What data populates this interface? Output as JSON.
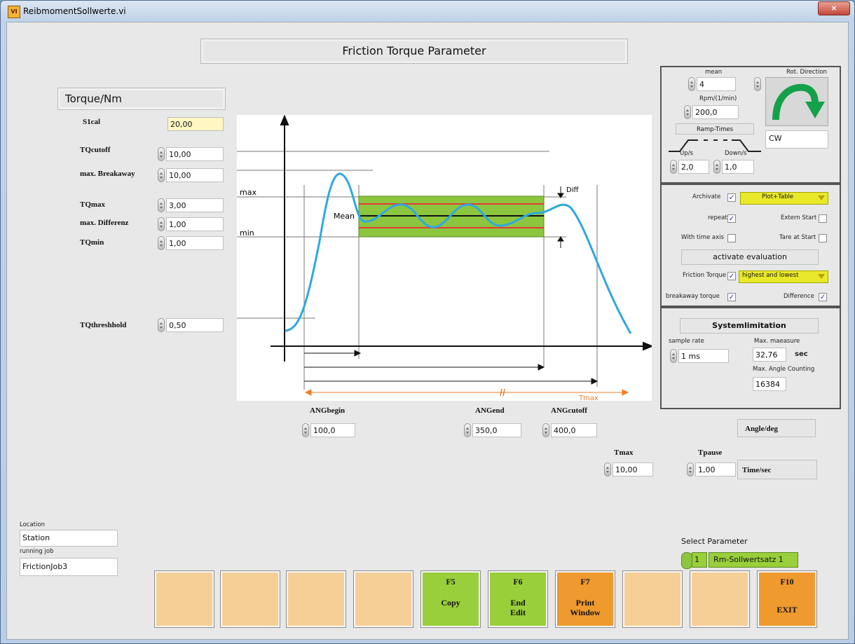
{
  "window": {
    "title": "ReibmomentSollwerte.vi",
    "app_icon": "labview-vi-icon",
    "close_glyph": "×"
  },
  "panel_title": "Friction Torque Parameter",
  "torque": {
    "heading": "Torque/Nm",
    "s1cal": {
      "label": "S1cal",
      "value": "20,00"
    },
    "tqcutoff": {
      "label": "TQcutoff",
      "value": "10,00"
    },
    "max_breakaway": {
      "label": "max. Breakaway",
      "value": "10,00"
    },
    "tqmax": {
      "label": "TQmax",
      "value": "3,00"
    },
    "max_differenz": {
      "label": "max. Differenz",
      "value": "1,00"
    },
    "tqmin": {
      "label": "TQmin",
      "value": "1,00"
    },
    "tqthreshhold": {
      "label": "TQthreshhold",
      "value": "0,50"
    }
  },
  "diagram": {
    "max": "max",
    "mean": "Mean",
    "min": "min",
    "diff": "Diff",
    "tmax": "Tmax",
    "colors": {
      "band": "#8cc63f",
      "red": "#e53935",
      "curve": "#2fa8e0",
      "arrow": "#f07d2a"
    }
  },
  "angles": {
    "angbegin": {
      "label": "ANGbegin",
      "value": "100,0"
    },
    "angend": {
      "label": "ANGend",
      "value": "350,0"
    },
    "angcutoff": {
      "label": "ANGcutoff",
      "value": "400,0"
    },
    "unit": "Angle/deg"
  },
  "times": {
    "tmax": {
      "label": "Tmax",
      "value": "10,00"
    },
    "tpause": {
      "label": "Tpause",
      "value": "1,00"
    },
    "unit": "Time/sec"
  },
  "drive": {
    "mean_label": "mean",
    "mean_value": "4",
    "rpm_label": "Rpm/(1/min)",
    "rpm_value": "200,0",
    "ramp_label": "Ramp-Times",
    "up_label": "Up/s",
    "up_value": "2,0",
    "down_label": "Down/s",
    "down_value": "1,0",
    "rot_label": "Rot. Direction",
    "rot_value": "CW"
  },
  "options": {
    "archivate": "Archivate",
    "archivate_mode": "Plot+Table",
    "repeat": "repeat",
    "extern_start": "Extern Start",
    "time_axis": "With time axis",
    "tare": "Tare at Start",
    "activate_eval": "activate evaluation",
    "friction_torque": "Friction Torque",
    "friction_mode": "highest and lowest",
    "breakaway": "breakaway torque",
    "difference": "Difference",
    "check": "✓"
  },
  "system": {
    "title": "Systemlimitation",
    "sample_rate_label": "sample rate",
    "sample_rate_value": "1 ms",
    "max_measure_label": "Max. maeasure",
    "max_measure_value": "32,76",
    "sec": "sec",
    "max_angle_label": "Max. Angle Counting",
    "max_angle_value": "16384"
  },
  "location": {
    "label": "Location",
    "value": "Station",
    "job_label": "running job",
    "job_value": "FrictionJob3"
  },
  "select_parameter": {
    "label": "Select Parameter",
    "index": "1",
    "name": "Rm-Sollwertsatz 1"
  },
  "fkeys": [
    {
      "key": "",
      "text": ""
    },
    {
      "key": "",
      "text": ""
    },
    {
      "key": "",
      "text": ""
    },
    {
      "key": "",
      "text": ""
    },
    {
      "key": "F5",
      "text": "Copy"
    },
    {
      "key": "F6",
      "text": "End\nEdit"
    },
    {
      "key": "F7",
      "text": "Print\nWindow"
    },
    {
      "key": "",
      "text": ""
    },
    {
      "key": "",
      "text": ""
    },
    {
      "key": "F10",
      "text": "EXIT"
    }
  ]
}
